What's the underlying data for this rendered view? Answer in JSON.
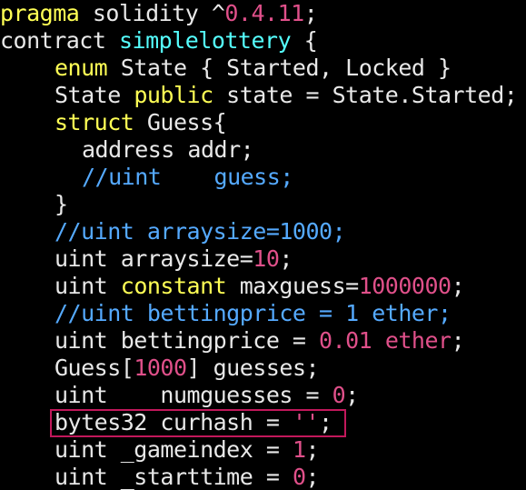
{
  "theme": {
    "background": "#000000",
    "plain": "#e8e8e8",
    "keyword": "#ffff55",
    "type": "#55ffff",
    "comment": "#55aaff",
    "number": "#e0508a",
    "highlight_border": "#c2185b"
  },
  "code": {
    "lines": [
      {
        "indent": 0,
        "tokens": [
          {
            "t": "pragma ",
            "c": "keyword"
          },
          {
            "t": "solidity ^",
            "c": "plain"
          },
          {
            "t": "0.4.11",
            "c": "number"
          },
          {
            "t": ";",
            "c": "plain"
          }
        ]
      },
      {
        "indent": 0,
        "tokens": [
          {
            "t": "contract ",
            "c": "plain"
          },
          {
            "t": "simplelottery",
            "c": "type"
          },
          {
            "t": " {",
            "c": "plain"
          }
        ]
      },
      {
        "indent": 2,
        "tokens": [
          {
            "t": "enum",
            "c": "keyword"
          },
          {
            "t": " State { Started, Locked }",
            "c": "plain"
          }
        ]
      },
      {
        "indent": 2,
        "tokens": [
          {
            "t": "State ",
            "c": "plain"
          },
          {
            "t": "public",
            "c": "keyword"
          },
          {
            "t": " state = State.Started;",
            "c": "plain"
          }
        ]
      },
      {
        "indent": 2,
        "tokens": [
          {
            "t": "struct",
            "c": "keyword"
          },
          {
            "t": " Guess{",
            "c": "plain"
          }
        ]
      },
      {
        "indent": 3,
        "tokens": [
          {
            "t": "address addr;",
            "c": "plain"
          }
        ]
      },
      {
        "indent": 3,
        "tokens": [
          {
            "t": "//uint    guess;",
            "c": "comment"
          }
        ]
      },
      {
        "indent": 2,
        "tokens": [
          {
            "t": "}",
            "c": "plain"
          }
        ]
      },
      {
        "indent": 2,
        "tokens": [
          {
            "t": "//uint arraysize=1000;",
            "c": "comment"
          }
        ]
      },
      {
        "indent": 2,
        "tokens": [
          {
            "t": "uint arraysize=",
            "c": "plain"
          },
          {
            "t": "10",
            "c": "number"
          },
          {
            "t": ";",
            "c": "plain"
          }
        ]
      },
      {
        "indent": 2,
        "tokens": [
          {
            "t": "uint ",
            "c": "plain"
          },
          {
            "t": "constant",
            "c": "keyword"
          },
          {
            "t": " maxguess=",
            "c": "plain"
          },
          {
            "t": "1000000",
            "c": "number"
          },
          {
            "t": ";",
            "c": "plain"
          }
        ]
      },
      {
        "indent": 2,
        "tokens": [
          {
            "t": "//uint bettingprice = 1 ether;",
            "c": "comment"
          }
        ]
      },
      {
        "indent": 2,
        "tokens": [
          {
            "t": "uint bettingprice = ",
            "c": "plain"
          },
          {
            "t": "0.01",
            "c": "number"
          },
          {
            "t": " ",
            "c": "plain"
          },
          {
            "t": "ether",
            "c": "number"
          },
          {
            "t": ";",
            "c": "plain"
          }
        ]
      },
      {
        "indent": 2,
        "tokens": [
          {
            "t": "Guess[",
            "c": "plain"
          },
          {
            "t": "1000",
            "c": "number"
          },
          {
            "t": "] guesses;",
            "c": "plain"
          }
        ]
      },
      {
        "indent": 2,
        "tokens": [
          {
            "t": "uint    numguesses = ",
            "c": "plain"
          },
          {
            "t": "0",
            "c": "number"
          },
          {
            "t": ";",
            "c": "plain"
          }
        ]
      },
      {
        "indent": 2,
        "tokens": [
          {
            "t": "bytes32 curhash = ",
            "c": "plain"
          },
          {
            "t": "''",
            "c": "number"
          },
          {
            "t": ";",
            "c": "plain"
          }
        ]
      },
      {
        "indent": 2,
        "tokens": [
          {
            "t": "uint _gameindex = ",
            "c": "plain"
          },
          {
            "t": "1",
            "c": "number"
          },
          {
            "t": ";",
            "c": "plain"
          }
        ]
      },
      {
        "indent": 2,
        "tokens": [
          {
            "t": "uint _starttime = ",
            "c": "plain"
          },
          {
            "t": "0",
            "c": "number"
          },
          {
            "t": ";",
            "c": "plain"
          }
        ]
      }
    ]
  }
}
